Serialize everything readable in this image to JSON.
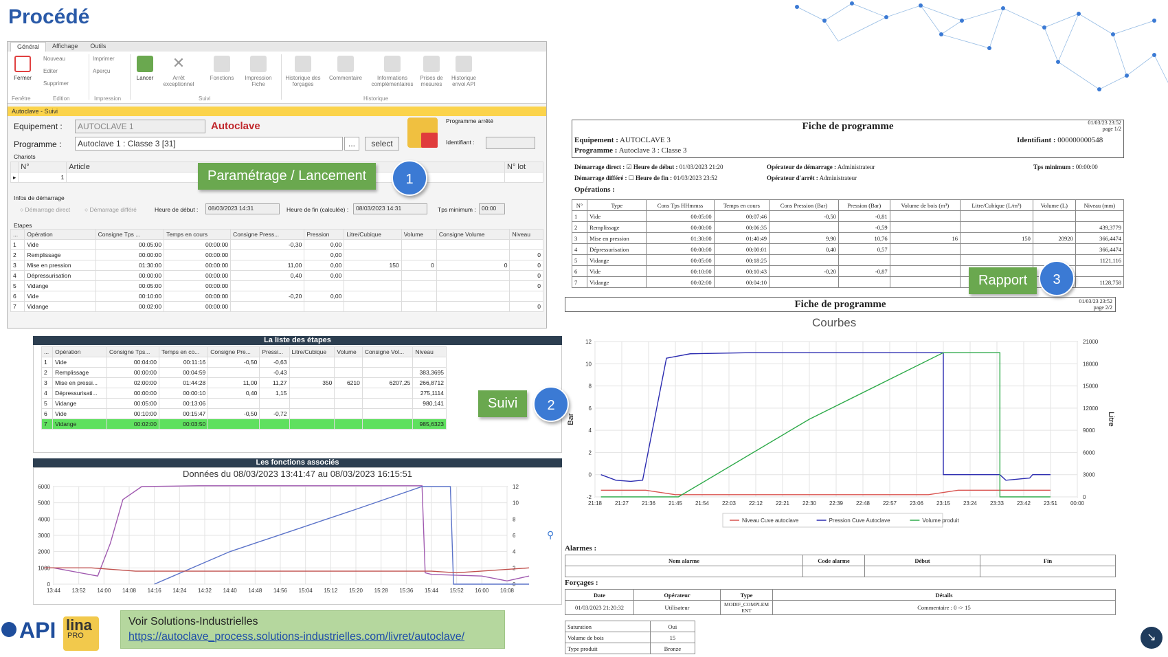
{
  "page_title": "Procédé",
  "app": {
    "tabs": [
      "Général",
      "Affichage",
      "Outils"
    ],
    "ribbon": {
      "fermer": "Fermer",
      "nouveau": "Nouveau",
      "editer": "Editer",
      "supprimer": "Supprimer",
      "imprimer": "Imprimer",
      "apercu": "Aperçu",
      "lancer": "Lancer",
      "arret": "Arrêt exceptionnel",
      "fonctions": "Fonctions",
      "impression_fiche": "Impression Fiche",
      "historique_forcages": "Historique des forçages",
      "commentaire": "Commentaire",
      "informations": "Informations complémentaires",
      "prises": "Prises de mesures",
      "historique_api": "Historique envoi API",
      "groups": [
        "Fenêtre",
        "Edition",
        "Impression",
        "Suivi",
        "Historique"
      ]
    },
    "window_caption": "Autoclave - Suivi",
    "equipement_label": "Equipement :",
    "equipement_value": "AUTOCLAVE 1",
    "equipement_name": "Autoclave",
    "programme_label": "Programme :",
    "programme_value": "Autoclave 1 : Classe 3 [31]",
    "ellipsis": "...",
    "select": "select",
    "programme_status": "Programme arrêté",
    "identifiant_label": "Identifiant :",
    "chariots_label": "Chariots",
    "chariots_headers": [
      "N°",
      "Article",
      "N° lot"
    ],
    "chariots_row": [
      "1"
    ],
    "infos_label": "Infos de démarrage",
    "demarrage_direct": "Démarrage direct",
    "demarrage_differe": "Démarrage différé",
    "heure_debut_label": "Heure de début :",
    "heure_debut": "08/03/2023 14:31",
    "heure_fin_label": "Heure de fin (calculée) :",
    "heure_fin": "08/03/2023 14:31",
    "tps_min_label": "Tps minimum :",
    "tps_min": "00:00",
    "etapes_label": "Etapes",
    "etapes_headers": [
      "...",
      "Opération",
      "Consigne Tps ...",
      "Temps en cours",
      "Consigne Press...",
      "Pression",
      "Litre/Cubique",
      "Volume",
      "Consigne Volume",
      "Niveau"
    ],
    "etapes_rows": [
      [
        "1",
        "Vide",
        "00:05:00",
        "00:00:00",
        "-0,30",
        "0,00",
        "",
        "",
        "",
        ""
      ],
      [
        "2",
        "Remplissage",
        "00:00:00",
        "00:00:00",
        "",
        "0,00",
        "",
        "",
        "",
        "0"
      ],
      [
        "3",
        "Mise en pression",
        "01:30:00",
        "00:00:00",
        "11,00",
        "0,00",
        "150",
        "0",
        "0",
        "0"
      ],
      [
        "4",
        "Dépressurisation",
        "00:00:00",
        "00:00:00",
        "0,40",
        "0,00",
        "",
        "",
        "",
        "0"
      ],
      [
        "5",
        "Vidange",
        "00:05:00",
        "00:00:00",
        "",
        "",
        "",
        "",
        "",
        "0"
      ],
      [
        "6",
        "Vide",
        "00:10:00",
        "00:00:00",
        "-0,20",
        "0,00",
        "",
        "",
        "",
        ""
      ],
      [
        "7",
        "Vidange",
        "00:02:00",
        "00:00:00",
        "",
        "",
        "",
        "",
        "",
        "0"
      ]
    ]
  },
  "tag1": {
    "label": "Paramétrage / Lancement",
    "num": "1"
  },
  "tag2": {
    "label": "Suivi",
    "num": "2"
  },
  "tag3": {
    "label": "Rapport",
    "num": "3"
  },
  "liste": {
    "title": "La liste des étapes",
    "headers": [
      "...",
      "Opération",
      "Consigne Tps...",
      "Temps en co...",
      "Consigne Pre...",
      "Pressi...",
      "Litre/Cubique",
      "Volume",
      "Consigne Vol...",
      "Niveau"
    ],
    "rows": [
      [
        "1",
        "Vide",
        "00:04:00",
        "00:11:16",
        "-0,50",
        "-0,63",
        "",
        "",
        "",
        ""
      ],
      [
        "2",
        "Remplissage",
        "00:00:00",
        "00:04:59",
        "",
        "-0,43",
        "",
        "",
        "",
        "383,3695"
      ],
      [
        "3",
        "Mise en pressi...",
        "02:00:00",
        "01:44:28",
        "11,00",
        "11,27",
        "350",
        "6210",
        "6207,25",
        "266,8712"
      ],
      [
        "4",
        "Dépressurisati...",
        "00:00:00",
        "00:00:10",
        "0,40",
        "1,15",
        "",
        "",
        "",
        "275,1114"
      ],
      [
        "5",
        "Vidange",
        "00:05:00",
        "00:13:06",
        "",
        "",
        "",
        "",
        "",
        "980,141"
      ],
      [
        "6",
        "Vide",
        "00:10:00",
        "00:15:47",
        "-0,50",
        "-0,72",
        "",
        "",
        "",
        ""
      ],
      [
        "7",
        "Vidange",
        "00:02:00",
        "00:03:50",
        "",
        "",
        "",
        "",
        "",
        "985,6323"
      ]
    ]
  },
  "fonctions": {
    "title": "Les fonctions associés",
    "chart_title": "Données du 08/03/2023 13:41:47 au 08/03/2023 16:15:51"
  },
  "rapport": {
    "heading": "Fiche de programme",
    "stamp1": "01/03/23 23:52",
    "page1": "page 1/2",
    "equip_label": "Equipement :",
    "equip": "AUTOCLAVE 3",
    "prog_label": "Programme :",
    "prog": "Autoclave 3 : Classe 3",
    "ident_label": "Identifiant :",
    "ident": "000000000548",
    "dem_direct": "Démarrage direct :",
    "dem_differe": "Démarrage différé :",
    "heure_debut_label": "Heure de début :",
    "heure_debut": "01/03/2023 21:20",
    "heure_fin_label": "Heure de fin :",
    "heure_fin": "01/03/2023 23:52",
    "op_dem_label": "Opérateur de démarrage :",
    "op_dem": "Administrateur",
    "op_arret_label": "Opérateur d'arrêt :",
    "op_arret": "Administrateur",
    "tps_min_label": "Tps minimum :",
    "tps_min": "00:00:00",
    "operations_label": "Opérations :",
    "ops_headers": [
      "N°",
      "Type",
      "Cons Tps HHmmss",
      "Temps en cours",
      "Cons Pression (Bar)",
      "Pression (Bar)",
      "Volume de bois (m³)",
      "Litre/Cubique (L/m³)",
      "Volume (L)",
      "Niveau (mm)"
    ],
    "ops_rows": [
      [
        "1",
        "Vide",
        "00:05:00",
        "00:07:46",
        "-0,50",
        "-0,81",
        "",
        "",
        "",
        ""
      ],
      [
        "2",
        "Remplissage",
        "00:00:00",
        "00:06:35",
        "",
        "-0,59",
        "",
        "",
        "",
        "439,3779"
      ],
      [
        "3",
        "Mise en pression",
        "01:30:00",
        "01:40:49",
        "9,90",
        "10,76",
        "16",
        "150",
        "20920",
        "366,4474"
      ],
      [
        "4",
        "Dépressurisation",
        "00:00:00",
        "00:00:01",
        "0,40",
        "0,57",
        "",
        "",
        "",
        "366,4474"
      ],
      [
        "5",
        "Vidange",
        "00:05:00",
        "00:18:25",
        "",
        "",
        "",
        "",
        "",
        "1121,116"
      ],
      [
        "6",
        "Vide",
        "00:10:00",
        "00:10:43",
        "-0,20",
        "-0,87",
        "",
        "",
        "",
        ""
      ],
      [
        "7",
        "Vidange",
        "00:02:00",
        "00:04:10",
        "",
        "",
        "",
        "",
        "",
        "1128,758"
      ]
    ],
    "stamp2": "01/03/23 23:52",
    "page2": "page 2/2",
    "courbes": "Courbes",
    "legend": [
      "Niveau Cuve autoclave",
      "Pression Cuve Autoclave",
      "Volume produit"
    ],
    "ylabel_left": "Bar",
    "ylabel_right": "Litre",
    "alarmes_label": "Alarmes :",
    "alarm_headers": [
      "Nom alarme",
      "Code alarme",
      "Début",
      "Fin"
    ],
    "forcages_label": "Forçages :",
    "forcage_headers": [
      "Date",
      "Opérateur",
      "Type",
      "Détails"
    ],
    "forcage_row": [
      "01/03/2023 21:20:32",
      "Utilisateur",
      "MODIF_COMPLEMENT",
      "Commentaire : 0 -> 15"
    ],
    "info_rows": [
      [
        "Saturation",
        "Oui"
      ],
      [
        "Volume de bois",
        "15"
      ],
      [
        "Type produit",
        "Bronze"
      ]
    ]
  },
  "footer": {
    "voir": "Voir Solutions-Industrielles",
    "link": "https://autoclave_process.solutions-industrielles.com/livret/autoclave/",
    "logo_api": "API",
    "logo_lina": "lina",
    "logo_pro": "PRO"
  },
  "chart_data": [
    {
      "type": "line",
      "title": "Données du 08/03/2023 13:41:47 au 08/03/2023 16:15:51",
      "x_ticks": [
        "13:44",
        "13:52",
        "14:00",
        "14:08",
        "14:16",
        "14:24",
        "14:32",
        "14:40",
        "14:48",
        "14:56",
        "15:04",
        "15:12",
        "15:20",
        "15:28",
        "15:36",
        "15:44",
        "15:52",
        "16:00",
        "16:08"
      ],
      "y_left_ticks": [
        0,
        1000,
        2000,
        3000,
        4000,
        5000,
        6000
      ],
      "y_right_ticks": [
        0,
        2,
        4,
        6,
        8,
        10,
        12
      ],
      "series": [
        {
          "color": "#a05ab0",
          "x": [
            "13:41",
            "13:44",
            "13:58",
            "14:02",
            "14:06",
            "14:12",
            "14:30",
            "15:00",
            "15:30",
            "15:41",
            "15:42",
            "15:44",
            "16:00",
            "16:08",
            "16:15"
          ],
          "y": [
            1000,
            1000,
            500,
            2500,
            5200,
            6000,
            6050,
            6050,
            6050,
            6050,
            700,
            600,
            500,
            200,
            500
          ]
        },
        {
          "color": "#5b73c9",
          "x": [
            "14:16",
            "14:40",
            "15:00",
            "15:20",
            "15:41",
            "15:50",
            "15:51",
            "16:15"
          ],
          "y": [
            0,
            2000,
            3300,
            4600,
            6000,
            6000,
            0,
            0
          ]
        },
        {
          "color": "#c0504d",
          "x": [
            "13:41",
            "13:56",
            "14:10",
            "15:44",
            "15:52",
            "16:15"
          ],
          "y": [
            1000,
            1000,
            800,
            800,
            700,
            1000
          ]
        }
      ]
    },
    {
      "type": "line",
      "title": "Courbes",
      "x_ticks": [
        "21:18",
        "21:27",
        "21:36",
        "21:45",
        "21:54",
        "22:03",
        "22:12",
        "22:21",
        "22:30",
        "22:39",
        "22:48",
        "22:57",
        "23:06",
        "23:15",
        "23:24",
        "23:33",
        "23:42",
        "23:51",
        "00:00"
      ],
      "y_left_ticks": [
        -2,
        0,
        2,
        4,
        6,
        8,
        10,
        12
      ],
      "y_right_ticks": [
        0,
        3000,
        6000,
        9000,
        12000,
        15000,
        18000,
        21000
      ],
      "ylabel_left": "Bar",
      "ylabel_right": "Litre",
      "series": [
        {
          "name": "Niveau Cuve autoclave",
          "color": "#d9534f",
          "x": [
            "21:20",
            "21:35",
            "21:45",
            "23:10",
            "23:20",
            "23:51"
          ],
          "y": [
            -1.4,
            -1.4,
            -1.8,
            -1.8,
            -1.4,
            -1.4
          ]
        },
        {
          "name": "Pression Cuve Autoclave",
          "color": "#2b2bb0",
          "x": [
            "21:20",
            "21:25",
            "21:30",
            "21:34",
            "21:38",
            "21:42",
            "21:50",
            "22:10",
            "23:15",
            "23:15",
            "23:34",
            "23:36",
            "23:44",
            "23:45",
            "23:51"
          ],
          "y": [
            0,
            -0.5,
            -0.6,
            -0.5,
            5,
            10.5,
            10.9,
            11,
            11,
            0,
            0,
            -0.5,
            -0.3,
            0,
            0
          ]
        },
        {
          "name": "Volume produit",
          "color": "#2eaa4a",
          "x": [
            "21:20",
            "21:46",
            "22:30",
            "23:15",
            "23:34",
            "23:34",
            "23:51"
          ],
          "y": [
            -2,
            -2,
            5,
            11,
            11,
            -2,
            -2
          ]
        }
      ]
    }
  ]
}
